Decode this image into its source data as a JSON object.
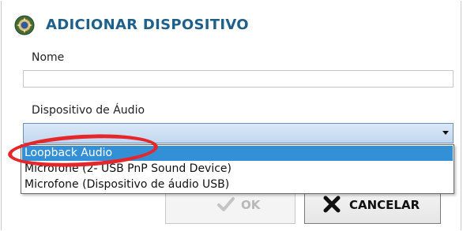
{
  "dialog": {
    "title": "ADICIONAR DISPOSITIVO",
    "title_color": "#1f5f8b"
  },
  "form": {
    "nome_label": "Nome",
    "nome_value": "",
    "audio_label": "Dispositivo de Áudio",
    "audio_selected": ""
  },
  "dropdown": {
    "options": [
      "Loopback Audio",
      "Microfone (2- USB PnP Sound Device)",
      "Microfone (Dispositivo de áudio USB)"
    ],
    "highlighted_index": 0,
    "highlight_color": "#3390d6",
    "annotation_color": "#e5262b"
  },
  "buttons": {
    "ok_label": "OK",
    "ok_enabled": false,
    "cancel_label": "CANCELAR"
  },
  "icons": {
    "header": "app-emblem-icon",
    "ok": "checkmark-icon",
    "cancel": "x-icon"
  }
}
